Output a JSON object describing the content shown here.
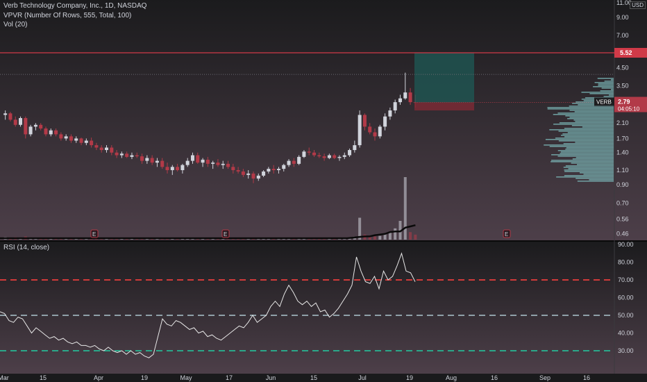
{
  "symbol": {
    "title": "Verb Technology Company, Inc., 1D, NASDAQ",
    "indicator_vpvr": "VPVR (Number Of Rows, 555, Total, 100)",
    "indicator_vol": "Vol (20)",
    "rsi_title": "RSI (14, close)",
    "currency": "USD",
    "ticker_badge": "VERB",
    "last_price": "2.79",
    "countdown": "04:05:10",
    "target_price": "5.52",
    "earnings_marker": "E"
  },
  "colors": {
    "up": "#d1d4dc",
    "down": "#b23a48",
    "target_line": "#d13a48",
    "vpvr": "#7fbfbf",
    "rsi_line": "#e8e8e8",
    "rsi_upper": "#d13a3a",
    "rsi_mid": "#8fa0a8",
    "rsi_lower": "#2aa88a",
    "profit_box": "#1e5a55",
    "loss_box": "#7a2a35"
  },
  "chart_data": {
    "type": "candlestick",
    "scale": "log",
    "y_ticks": [
      "11.00",
      "9.00",
      "7.00",
      "5.52",
      "4.50",
      "3.50",
      "2.79",
      "2.10",
      "1.70",
      "1.40",
      "1.10",
      "0.90",
      "0.70",
      "0.56",
      "0.46"
    ],
    "x_labels": [
      "Mar",
      "15",
      "Apr",
      "19",
      "May",
      "17",
      "Jun",
      "15",
      "Jul",
      "19",
      "Aug",
      "16",
      "Sep",
      "16"
    ],
    "ohlc": [
      [
        2.35,
        2.5,
        2.2,
        2.4
      ],
      [
        2.4,
        2.45,
        2.15,
        2.2
      ],
      [
        2.2,
        2.3,
        2.0,
        2.05
      ],
      [
        2.05,
        2.3,
        2.0,
        2.25
      ],
      [
        2.25,
        2.3,
        1.7,
        1.8
      ],
      [
        1.8,
        2.05,
        1.75,
        2.0
      ],
      [
        2.0,
        2.1,
        1.9,
        2.05
      ],
      [
        2.05,
        2.1,
        1.9,
        1.95
      ],
      [
        1.95,
        2.0,
        1.75,
        1.8
      ],
      [
        1.8,
        1.95,
        1.75,
        1.9
      ],
      [
        1.9,
        1.95,
        1.75,
        1.8
      ],
      [
        1.8,
        1.85,
        1.65,
        1.7
      ],
      [
        1.7,
        1.8,
        1.65,
        1.75
      ],
      [
        1.75,
        1.8,
        1.6,
        1.65
      ],
      [
        1.65,
        1.75,
        1.6,
        1.7
      ],
      [
        1.7,
        1.72,
        1.55,
        1.6
      ],
      [
        1.6,
        1.7,
        1.55,
        1.65
      ],
      [
        1.65,
        1.72,
        1.5,
        1.55
      ],
      [
        1.55,
        1.6,
        1.45,
        1.5
      ],
      [
        1.5,
        1.55,
        1.4,
        1.45
      ],
      [
        1.45,
        1.55,
        1.4,
        1.5
      ],
      [
        1.5,
        1.55,
        1.35,
        1.4
      ],
      [
        1.4,
        1.45,
        1.3,
        1.35
      ],
      [
        1.35,
        1.42,
        1.3,
        1.38
      ],
      [
        1.38,
        1.42,
        1.3,
        1.32
      ],
      [
        1.32,
        1.4,
        1.28,
        1.35
      ],
      [
        1.35,
        1.4,
        1.3,
        1.33
      ],
      [
        1.33,
        1.38,
        1.2,
        1.25
      ],
      [
        1.25,
        1.35,
        1.2,
        1.3
      ],
      [
        1.3,
        1.35,
        1.18,
        1.22
      ],
      [
        1.22,
        1.3,
        1.15,
        1.25
      ],
      [
        1.25,
        1.3,
        1.12,
        1.15
      ],
      [
        1.15,
        1.22,
        1.05,
        1.1
      ],
      [
        1.1,
        1.18,
        1.03,
        1.15
      ],
      [
        1.15,
        1.2,
        1.08,
        1.1
      ],
      [
        1.1,
        1.2,
        1.05,
        1.18
      ],
      [
        1.18,
        1.3,
        1.15,
        1.25
      ],
      [
        1.25,
        1.4,
        1.2,
        1.35
      ],
      [
        1.35,
        1.4,
        1.2,
        1.22
      ],
      [
        1.22,
        1.3,
        1.15,
        1.27
      ],
      [
        1.27,
        1.32,
        1.15,
        1.2
      ],
      [
        1.2,
        1.25,
        1.12,
        1.22
      ],
      [
        1.22,
        1.28,
        1.15,
        1.18
      ],
      [
        1.18,
        1.25,
        1.12,
        1.2
      ],
      [
        1.2,
        1.25,
        1.12,
        1.15
      ],
      [
        1.15,
        1.2,
        1.05,
        1.1
      ],
      [
        1.1,
        1.15,
        1.05,
        1.08
      ],
      [
        1.08,
        1.12,
        1.0,
        1.03
      ],
      [
        1.03,
        1.1,
        0.98,
        1.05
      ],
      [
        1.05,
        1.08,
        0.92,
        0.98
      ],
      [
        0.98,
        1.05,
        0.95,
        1.02
      ],
      [
        1.02,
        1.1,
        1.0,
        1.08
      ],
      [
        1.08,
        1.15,
        1.05,
        1.12
      ],
      [
        1.12,
        1.18,
        1.05,
        1.1
      ],
      [
        1.1,
        1.15,
        1.05,
        1.12
      ],
      [
        1.12,
        1.2,
        1.08,
        1.18
      ],
      [
        1.18,
        1.28,
        1.15,
        1.25
      ],
      [
        1.25,
        1.3,
        1.15,
        1.2
      ],
      [
        1.2,
        1.35,
        1.18,
        1.32
      ],
      [
        1.32,
        1.45,
        1.3,
        1.42
      ],
      [
        1.42,
        1.5,
        1.35,
        1.4
      ],
      [
        1.4,
        1.45,
        1.32,
        1.35
      ],
      [
        1.35,
        1.4,
        1.3,
        1.33
      ],
      [
        1.33,
        1.38,
        1.25,
        1.3
      ],
      [
        1.3,
        1.38,
        1.28,
        1.35
      ],
      [
        1.35,
        1.38,
        1.28,
        1.3
      ],
      [
        1.3,
        1.35,
        1.25,
        1.32
      ],
      [
        1.32,
        1.4,
        1.28,
        1.35
      ],
      [
        1.35,
        1.48,
        1.32,
        1.45
      ],
      [
        1.45,
        1.65,
        1.4,
        1.55
      ],
      [
        1.55,
        2.5,
        1.5,
        2.35
      ],
      [
        2.35,
        2.4,
        1.9,
        2.0
      ],
      [
        2.0,
        2.1,
        1.8,
        1.85
      ],
      [
        1.85,
        1.95,
        1.65,
        1.75
      ],
      [
        1.75,
        2.05,
        1.7,
        2.0
      ],
      [
        2.0,
        2.4,
        1.9,
        2.3
      ],
      [
        2.3,
        2.6,
        2.2,
        2.5
      ],
      [
        2.5,
        2.9,
        2.4,
        2.8
      ],
      [
        2.8,
        3.1,
        2.7,
        2.95
      ],
      [
        2.95,
        4.2,
        2.9,
        3.2
      ],
      [
        3.2,
        3.4,
        2.7,
        2.8
      ],
      [
        2.8,
        3.1,
        2.6,
        2.79
      ]
    ],
    "volume_relative": [
      0.04,
      0.03,
      0.04,
      0.03,
      0.05,
      0.03,
      0.02,
      0.02,
      0.03,
      0.02,
      0.02,
      0.03,
      0.02,
      0.02,
      0.02,
      0.02,
      0.02,
      0.03,
      0.02,
      0.02,
      0.02,
      0.02,
      0.02,
      0.02,
      0.02,
      0.02,
      0.02,
      0.03,
      0.02,
      0.02,
      0.02,
      0.03,
      0.03,
      0.02,
      0.02,
      0.02,
      0.03,
      0.03,
      0.02,
      0.02,
      0.02,
      0.02,
      0.02,
      0.02,
      0.02,
      0.02,
      0.02,
      0.02,
      0.02,
      0.03,
      0.02,
      0.02,
      0.02,
      0.02,
      0.02,
      0.02,
      0.03,
      0.02,
      0.03,
      0.03,
      0.02,
      0.02,
      0.02,
      0.02,
      0.02,
      0.02,
      0.02,
      0.02,
      0.03,
      0.05,
      0.35,
      0.08,
      0.05,
      0.05,
      0.06,
      0.1,
      0.12,
      0.18,
      0.3,
      1.0,
      0.12,
      0.08
    ],
    "volume_ma_relative": [
      0.04,
      0.04,
      0.06,
      0.07,
      0.08,
      0.11,
      0.12,
      0.12,
      0.18,
      0.2,
      0.22
    ],
    "rsi_levels": [
      70,
      50,
      30
    ],
    "rsi_ticks": [
      "90.00",
      "80.00",
      "70.00",
      "60.00",
      "50.00",
      "40.00",
      "30.00"
    ],
    "rsi": [
      52,
      51,
      47,
      46,
      49,
      48,
      44,
      40,
      43,
      41,
      39,
      37,
      38,
      36,
      37,
      35,
      34,
      35,
      33,
      33,
      32,
      33,
      31,
      30,
      32,
      30,
      29,
      30,
      28,
      30,
      28,
      29,
      27,
      26,
      28,
      38,
      48,
      45,
      44,
      47,
      46,
      44,
      42,
      43,
      40,
      41,
      38,
      39,
      37,
      36,
      38,
      40,
      42,
      44,
      43,
      46,
      50,
      46,
      48,
      50,
      55,
      58,
      55,
      62,
      67,
      63,
      58,
      56,
      58,
      55,
      57,
      52,
      53,
      49,
      51,
      54,
      58,
      62,
      67,
      83,
      75,
      69,
      68,
      72,
      65,
      75,
      70,
      72,
      78,
      85,
      75,
      74,
      69
    ],
    "target": 5.52,
    "last": 2.79,
    "stop": 2.5
  }
}
